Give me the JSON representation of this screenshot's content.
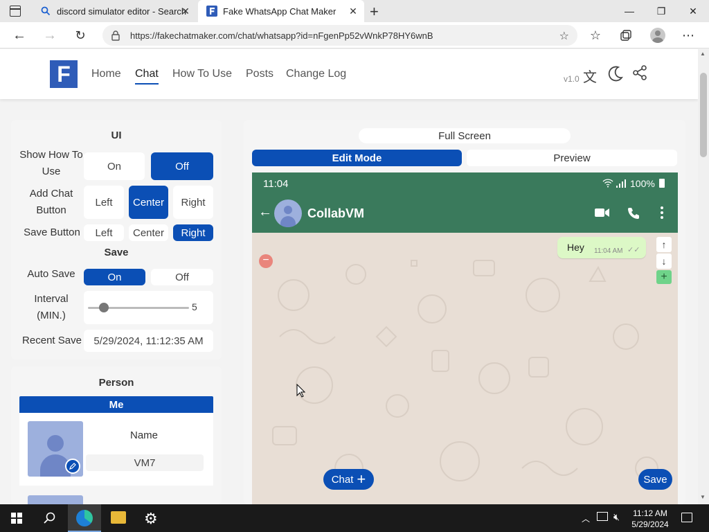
{
  "browser": {
    "tabs": [
      {
        "title": "discord simulator editor - Search"
      },
      {
        "title": "Fake WhatsApp Chat Maker"
      }
    ],
    "url": "https://fakechatmaker.com/chat/whatsapp?id=nFgenPp52vWnkP78HY6wnB"
  },
  "site": {
    "logo_letter": "F",
    "nav": [
      "Home",
      "Chat",
      "How To Use",
      "Posts",
      "Change Log"
    ],
    "version": "v1.0"
  },
  "ui_panel": {
    "title": "UI",
    "show_how_to_use": {
      "label": "Show How To Use",
      "options": [
        "On",
        "Off"
      ],
      "selected": "Off"
    },
    "add_chat_button": {
      "label": "Add Chat Button",
      "options": [
        "Left",
        "Center",
        "Right"
      ],
      "selected": "Center"
    },
    "save_button": {
      "label": "Save Button",
      "options": [
        "Left",
        "Center",
        "Right"
      ],
      "selected": "Right"
    },
    "save_title": "Save",
    "auto_save": {
      "label": "Auto Save",
      "options": [
        "On",
        "Off"
      ],
      "selected": "On"
    },
    "interval": {
      "label": "Interval (MIN.)",
      "value": "5"
    },
    "recent_save": {
      "label": "Recent Save",
      "value": "5/29/2024, 11:12:35 AM"
    }
  },
  "person_panel": {
    "title": "Person",
    "tab": "Me",
    "name_label": "Name",
    "name_value": "VM7"
  },
  "preview": {
    "fullscreen_label": "Full Screen",
    "modes": [
      "Edit Mode",
      "Preview"
    ],
    "selected_mode": "Edit Mode",
    "status_time": "11:04",
    "battery": "100%",
    "contact_name": "CollabVM",
    "messages": [
      {
        "text": "Hey",
        "time": "11:04 AM",
        "side": "right"
      }
    ],
    "chat_button": "Chat",
    "save_button": "Save",
    "header_color": "#3a7a5c",
    "bubble_color": "#dcf8c6"
  },
  "taskbar": {
    "time": "11:12 AM",
    "date": "5/29/2024"
  },
  "colors": {
    "accent": "#0b4fb5",
    "logo": "#2f5cb8"
  }
}
